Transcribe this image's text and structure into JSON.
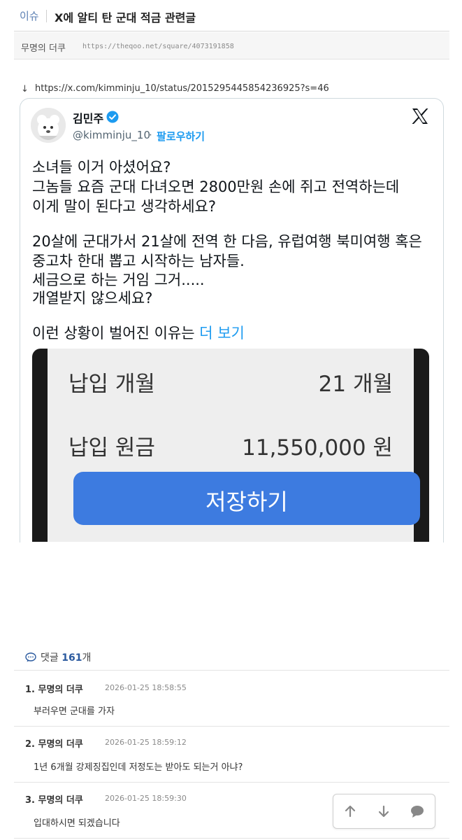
{
  "header": {
    "category": "이슈",
    "title": "X에 알티 탄 군대 적금 관련글"
  },
  "meta": {
    "author": "무명의 더쿠",
    "url": "https://theqoo.net/square/4073191858"
  },
  "source": {
    "arrow": "↓",
    "url": "https://x.com/kimminju_10/status/2015295445854236925?s=46"
  },
  "tweet": {
    "name": "김민주",
    "handle": "@kimminju_10",
    "dot": "·",
    "follow_label": "팔로우하기",
    "lines": [
      "소녀들 이거 아셨어요?",
      "그놈들 요즘 군대 다녀오면 2800만원 손에 쥐고 전역하는데",
      "이게 말이 된다고 생각하세요?",
      "20살에 군대가서 21살에 전역 한 다음, 유럽여행 북미여행 혹은",
      "중고차 한대 뽑고 시작하는 남자들.",
      "세금으로 하는 거임 그거.....",
      "개열받지 않으세요?",
      "이런 상황이 벌어진 이유는 "
    ],
    "more_label": "더 보기",
    "image": {
      "row1_label": "납입 개월",
      "row1_value": "21 개월",
      "row2_label": "납입 원금",
      "row2_value": "11,550,000 원",
      "save_label": "저장하기"
    }
  },
  "comments": {
    "label": "댓글",
    "count": "161",
    "suffix": "개",
    "items": [
      {
        "num": "1.",
        "author": "무명의 더쿠",
        "date": "2026-01-25 18:58:55",
        "body": "부러우면 군대를 가자"
      },
      {
        "num": "2.",
        "author": "무명의 더쿠",
        "date": "2026-01-25 18:59:12",
        "body": "1년 6개월 강제징집인데 저정도는 받아도 되는거 아냐?"
      },
      {
        "num": "3.",
        "author": "무명의 더쿠",
        "date": "2026-01-25 18:59:30",
        "body": "입대하시면 되겠습니다"
      }
    ]
  },
  "float_nav": {
    "up": "up-arrow-icon",
    "down": "down-arrow-icon",
    "comment": "comment-bubble-icon"
  },
  "colors": {
    "accent": "#1d9bf0",
    "save_button": "#3d7be0",
    "comment_count": "#2b5a9f"
  }
}
